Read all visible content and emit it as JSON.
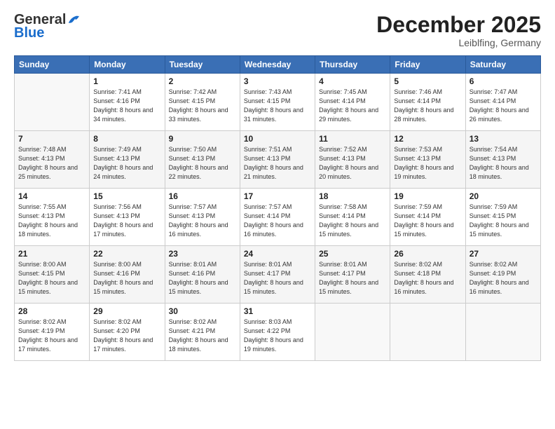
{
  "logo": {
    "general": "General",
    "blue": "Blue"
  },
  "header": {
    "month": "December 2025",
    "location": "Leiblfing, Germany"
  },
  "weekdays": [
    "Sunday",
    "Monday",
    "Tuesday",
    "Wednesday",
    "Thursday",
    "Friday",
    "Saturday"
  ],
  "weeks": [
    [
      {
        "day": "",
        "sunrise": "",
        "sunset": "",
        "daylight": ""
      },
      {
        "day": "1",
        "sunrise": "Sunrise: 7:41 AM",
        "sunset": "Sunset: 4:16 PM",
        "daylight": "Daylight: 8 hours and 34 minutes."
      },
      {
        "day": "2",
        "sunrise": "Sunrise: 7:42 AM",
        "sunset": "Sunset: 4:15 PM",
        "daylight": "Daylight: 8 hours and 33 minutes."
      },
      {
        "day": "3",
        "sunrise": "Sunrise: 7:43 AM",
        "sunset": "Sunset: 4:15 PM",
        "daylight": "Daylight: 8 hours and 31 minutes."
      },
      {
        "day": "4",
        "sunrise": "Sunrise: 7:45 AM",
        "sunset": "Sunset: 4:14 PM",
        "daylight": "Daylight: 8 hours and 29 minutes."
      },
      {
        "day": "5",
        "sunrise": "Sunrise: 7:46 AM",
        "sunset": "Sunset: 4:14 PM",
        "daylight": "Daylight: 8 hours and 28 minutes."
      },
      {
        "day": "6",
        "sunrise": "Sunrise: 7:47 AM",
        "sunset": "Sunset: 4:14 PM",
        "daylight": "Daylight: 8 hours and 26 minutes."
      }
    ],
    [
      {
        "day": "7",
        "sunrise": "Sunrise: 7:48 AM",
        "sunset": "Sunset: 4:13 PM",
        "daylight": "Daylight: 8 hours and 25 minutes."
      },
      {
        "day": "8",
        "sunrise": "Sunrise: 7:49 AM",
        "sunset": "Sunset: 4:13 PM",
        "daylight": "Daylight: 8 hours and 24 minutes."
      },
      {
        "day": "9",
        "sunrise": "Sunrise: 7:50 AM",
        "sunset": "Sunset: 4:13 PM",
        "daylight": "Daylight: 8 hours and 22 minutes."
      },
      {
        "day": "10",
        "sunrise": "Sunrise: 7:51 AM",
        "sunset": "Sunset: 4:13 PM",
        "daylight": "Daylight: 8 hours and 21 minutes."
      },
      {
        "day": "11",
        "sunrise": "Sunrise: 7:52 AM",
        "sunset": "Sunset: 4:13 PM",
        "daylight": "Daylight: 8 hours and 20 minutes."
      },
      {
        "day": "12",
        "sunrise": "Sunrise: 7:53 AM",
        "sunset": "Sunset: 4:13 PM",
        "daylight": "Daylight: 8 hours and 19 minutes."
      },
      {
        "day": "13",
        "sunrise": "Sunrise: 7:54 AM",
        "sunset": "Sunset: 4:13 PM",
        "daylight": "Daylight: 8 hours and 18 minutes."
      }
    ],
    [
      {
        "day": "14",
        "sunrise": "Sunrise: 7:55 AM",
        "sunset": "Sunset: 4:13 PM",
        "daylight": "Daylight: 8 hours and 18 minutes."
      },
      {
        "day": "15",
        "sunrise": "Sunrise: 7:56 AM",
        "sunset": "Sunset: 4:13 PM",
        "daylight": "Daylight: 8 hours and 17 minutes."
      },
      {
        "day": "16",
        "sunrise": "Sunrise: 7:57 AM",
        "sunset": "Sunset: 4:13 PM",
        "daylight": "Daylight: 8 hours and 16 minutes."
      },
      {
        "day": "17",
        "sunrise": "Sunrise: 7:57 AM",
        "sunset": "Sunset: 4:14 PM",
        "daylight": "Daylight: 8 hours and 16 minutes."
      },
      {
        "day": "18",
        "sunrise": "Sunrise: 7:58 AM",
        "sunset": "Sunset: 4:14 PM",
        "daylight": "Daylight: 8 hours and 15 minutes."
      },
      {
        "day": "19",
        "sunrise": "Sunrise: 7:59 AM",
        "sunset": "Sunset: 4:14 PM",
        "daylight": "Daylight: 8 hours and 15 minutes."
      },
      {
        "day": "20",
        "sunrise": "Sunrise: 7:59 AM",
        "sunset": "Sunset: 4:15 PM",
        "daylight": "Daylight: 8 hours and 15 minutes."
      }
    ],
    [
      {
        "day": "21",
        "sunrise": "Sunrise: 8:00 AM",
        "sunset": "Sunset: 4:15 PM",
        "daylight": "Daylight: 8 hours and 15 minutes."
      },
      {
        "day": "22",
        "sunrise": "Sunrise: 8:00 AM",
        "sunset": "Sunset: 4:16 PM",
        "daylight": "Daylight: 8 hours and 15 minutes."
      },
      {
        "day": "23",
        "sunrise": "Sunrise: 8:01 AM",
        "sunset": "Sunset: 4:16 PM",
        "daylight": "Daylight: 8 hours and 15 minutes."
      },
      {
        "day": "24",
        "sunrise": "Sunrise: 8:01 AM",
        "sunset": "Sunset: 4:17 PM",
        "daylight": "Daylight: 8 hours and 15 minutes."
      },
      {
        "day": "25",
        "sunrise": "Sunrise: 8:01 AM",
        "sunset": "Sunset: 4:17 PM",
        "daylight": "Daylight: 8 hours and 15 minutes."
      },
      {
        "day": "26",
        "sunrise": "Sunrise: 8:02 AM",
        "sunset": "Sunset: 4:18 PM",
        "daylight": "Daylight: 8 hours and 16 minutes."
      },
      {
        "day": "27",
        "sunrise": "Sunrise: 8:02 AM",
        "sunset": "Sunset: 4:19 PM",
        "daylight": "Daylight: 8 hours and 16 minutes."
      }
    ],
    [
      {
        "day": "28",
        "sunrise": "Sunrise: 8:02 AM",
        "sunset": "Sunset: 4:19 PM",
        "daylight": "Daylight: 8 hours and 17 minutes."
      },
      {
        "day": "29",
        "sunrise": "Sunrise: 8:02 AM",
        "sunset": "Sunset: 4:20 PM",
        "daylight": "Daylight: 8 hours and 17 minutes."
      },
      {
        "day": "30",
        "sunrise": "Sunrise: 8:02 AM",
        "sunset": "Sunset: 4:21 PM",
        "daylight": "Daylight: 8 hours and 18 minutes."
      },
      {
        "day": "31",
        "sunrise": "Sunrise: 8:03 AM",
        "sunset": "Sunset: 4:22 PM",
        "daylight": "Daylight: 8 hours and 19 minutes."
      },
      {
        "day": "",
        "sunrise": "",
        "sunset": "",
        "daylight": ""
      },
      {
        "day": "",
        "sunrise": "",
        "sunset": "",
        "daylight": ""
      },
      {
        "day": "",
        "sunrise": "",
        "sunset": "",
        "daylight": ""
      }
    ]
  ]
}
